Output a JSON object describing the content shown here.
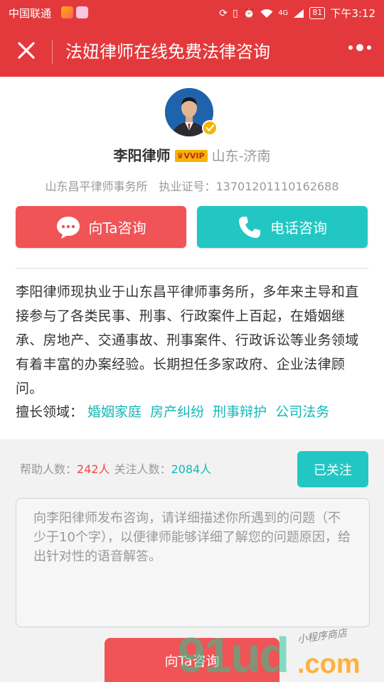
{
  "status_bar": {
    "carrier": "中国联通",
    "battery": "81",
    "time": "下午3:12",
    "network": "4G"
  },
  "nav": {
    "title": "法妞律师在线免费法律咨询"
  },
  "lawyer": {
    "name": "李阳律师",
    "vip_badge": "VVIP",
    "region": "山东-济南",
    "office": "山东昌平律师事务所",
    "license_label": "执业证号：",
    "license_no": "13701201110162688"
  },
  "actions": {
    "consult_label": "向Ta咨询",
    "phone_label": "电话咨询"
  },
  "intro": "李阳律师现执业于山东昌平律师事务所，多年来主导和直接参与了各类民事、刑事、行政案件上百起，在婚姻继承、房地产、交通事故、刑事案件、行政诉讼等业务领域有着丰富的办案经验。长期担任多家政府、企业法律顾问。",
  "expertise": {
    "label": "擅长领域：",
    "tags": [
      "婚姻家庭",
      "房产纠纷",
      "刑事辩护",
      "公司法务"
    ]
  },
  "stats": {
    "helped_label": "帮助人数：",
    "helped_value": "242人",
    "followers_label": "关注人数：",
    "followers_value": "2084人"
  },
  "follow_button": "已关注",
  "question": {
    "placeholder": "向李阳律师发布咨询，请详细描述你所遇到的问题（不少于10个字），以便律师能够详细了解您的问题原因，给出针对性的语音解答。"
  },
  "submit_button": "向Ta咨询",
  "watermark": {
    "big": "91ud",
    "com": ".com",
    "small": "小程序商店"
  },
  "colors": {
    "primary_red": "#e4393c",
    "button_red": "#f05456",
    "teal": "#22c7c4",
    "tag_teal": "#14b8b8"
  }
}
